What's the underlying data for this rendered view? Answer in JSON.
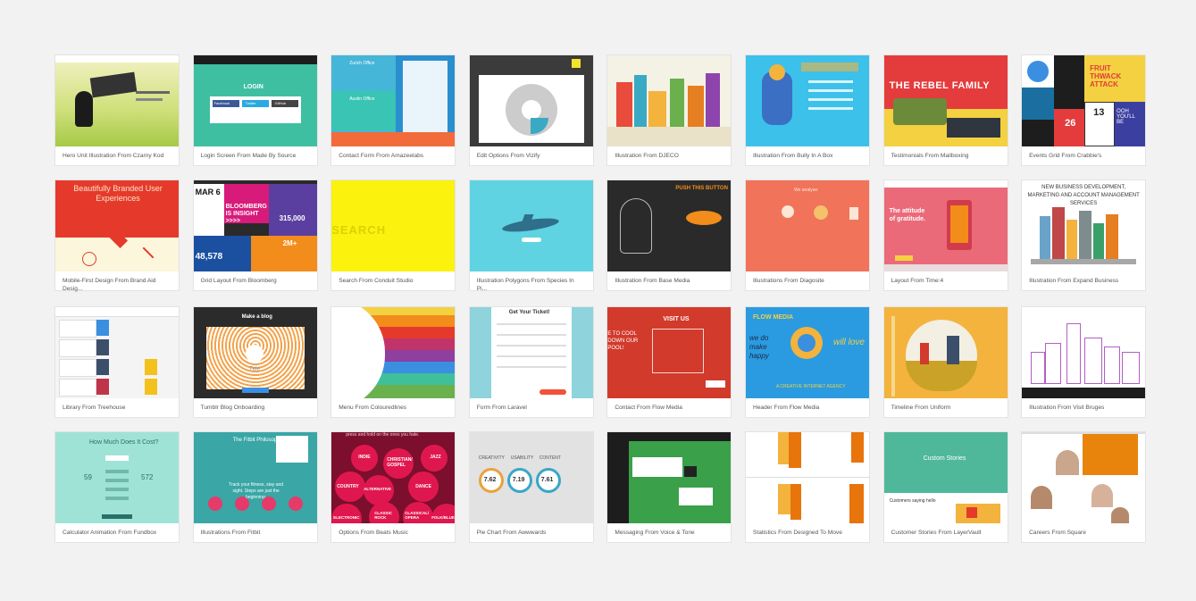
{
  "gallery": {
    "cards": [
      {
        "caption": "Hero Unit Illustration From Czarny Kod",
        "theme": "czarny"
      },
      {
        "caption": "Login Screen From Made By Source",
        "theme": "login"
      },
      {
        "caption": "Contact Form From Amazeelabs",
        "theme": "contact"
      },
      {
        "caption": "Edit Options From Vizify",
        "theme": "edit"
      },
      {
        "caption": "Illustration From DJECO",
        "theme": "djeco"
      },
      {
        "caption": "Illustration From Bully In A Box",
        "theme": "bully"
      },
      {
        "caption": "Testimonials From Mailboxing",
        "theme": "rebel"
      },
      {
        "caption": "Events Grid From Crabbie's",
        "theme": "events"
      },
      {
        "caption": "Mobile-First Design From Brand Aid Desig...",
        "theme": "brandaid"
      },
      {
        "caption": "Grid Layout From Bloomberg",
        "theme": "bloomberg"
      },
      {
        "caption": "Search From Conduit Studio",
        "theme": "search"
      },
      {
        "caption": "Illustration Polygons From Species In Pi...",
        "theme": "dolphin"
      },
      {
        "caption": "Illustration From Base Media",
        "theme": "basemedia"
      },
      {
        "caption": "Illustrations From Diagosite",
        "theme": "diagosite"
      },
      {
        "caption": "Layout From Time:4",
        "theme": "time4"
      },
      {
        "caption": "Illustration From Expand Business",
        "theme": "expand"
      },
      {
        "caption": "Library From Treehouse",
        "theme": "library"
      },
      {
        "caption": "Tumblr Blog Onboarding",
        "theme": "tumblr"
      },
      {
        "caption": "Menu From Colouredlines",
        "theme": "menu"
      },
      {
        "caption": "Form From Laravel",
        "theme": "laravel"
      },
      {
        "caption": "Contact From Flow Media",
        "theme": "flowcontact"
      },
      {
        "caption": "Header From Flow Media",
        "theme": "flowheader"
      },
      {
        "caption": "Timeline From Uniform",
        "theme": "timeline"
      },
      {
        "caption": "Illustration From Visit Bruges",
        "theme": "bruges"
      },
      {
        "caption": "Calculator Animation From Fundbox",
        "theme": "calc"
      },
      {
        "caption": "Illustrations From Fitbit",
        "theme": "fitbit"
      },
      {
        "caption": "Options From Beats Music",
        "theme": "beats"
      },
      {
        "caption": "Pie Chart From Awwwards",
        "theme": "pie"
      },
      {
        "caption": "Messaging From Voice & Tone",
        "theme": "messaging"
      },
      {
        "caption": "Statistics From Designed To Move",
        "theme": "stats"
      },
      {
        "caption": "Customer Stories From LayerVault",
        "theme": "layervault"
      },
      {
        "caption": "Careers From Square",
        "theme": "careers"
      }
    ],
    "thumb_text": {
      "login_title": "LOGIN",
      "login_facebook": "Facebook",
      "login_twitter": "Twitter",
      "login_github": "GitHub",
      "contact_zurich": "Zurich Office",
      "contact_austin": "Austin Office",
      "rebel_title": "THE REBEL FAMILY",
      "events_fruit": "FRUIT THWACK ATTACK",
      "events_13": "13",
      "events_26": "26",
      "events_ooh": "OOH YOU'LL BE",
      "brandaid_title": "Beautifully Branded User Experiences",
      "bloomberg_mar": "MAR 6",
      "bloomberg_insight": "BLOOMBERG IS INSIGHT >>>>",
      "bloomberg_num1": "315,000",
      "bloomberg_num2": "48,578",
      "bloomberg_num3": "2M+",
      "search_word": "SEARCH",
      "basemedia_push": "PUSH THIS BUTTON",
      "diagosite_text": "We analyse:",
      "time4_text": "The attitude of gratitude.",
      "expand_title": "NEW BUSINESS DEVELOPMENT, MARKETING AND ACCOUNT MANAGEMENT SERVICES",
      "tumblr_make": "Make a blog",
      "tumblr_title": "Title",
      "laravel_title": "Get Your Ticket!",
      "flowcontact_visit": "VISIT US",
      "flowcontact_cool": "E TO COOL DOWN OUR POOL!",
      "flowheader_brand": "FLOW MEDIA",
      "flowheader_we": "we do make happy",
      "flowheader_love": "will love",
      "flowheader_agency": "A CREATIVE INTERNET AGENCY",
      "calc_title": "How Much Does It Cost?",
      "calc_left": "59",
      "calc_right": "572",
      "fitbit_title": "The Fitbit Philosophy",
      "fitbit_sub": "Track your fitness, stay and sight. Steps are just the beginning.",
      "beats_top": "press and hold on the ones you hate.",
      "beats_indie": "INDIE",
      "beats_christian": "CHRISTIAN/ GOSPEL",
      "beats_jazz": "JAZZ",
      "beats_country": "COUNTRY",
      "beats_alternative": "ALTERNATIVE",
      "beats_dance": "DANCE",
      "beats_electronic": "ELECTRONIC",
      "beats_classicrock": "CLASSIC ROCK",
      "beats_classical": "CLASSICAL/ OPERA",
      "beats_folk": "FOLK/BLUE",
      "pie_creativity": "CREATIVITY",
      "pie_usability": "USABILITY",
      "pie_content": "CONTENT",
      "pie_v1": "7.62",
      "pie_v2": "7.19",
      "pie_v3": "7.61",
      "layervault_title": "Custom Stories",
      "layervault_sub": "Customers saying hello"
    }
  }
}
